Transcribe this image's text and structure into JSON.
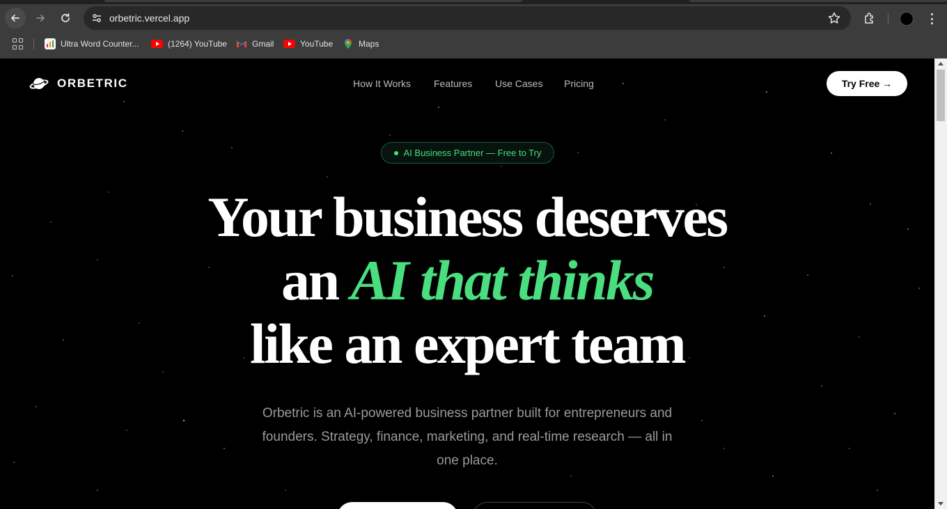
{
  "browser": {
    "url": "orbetric.vercel.app",
    "bookmarks": [
      {
        "label": "Ultra Word Counter...",
        "icon": "ultra-word-counter-favicon"
      },
      {
        "label": "(1264) YouTube",
        "icon": "youtube-favicon"
      },
      {
        "label": "Gmail",
        "icon": "gmail-favicon"
      },
      {
        "label": "YouTube",
        "icon": "youtube-favicon"
      },
      {
        "label": "Maps",
        "icon": "maps-favicon"
      }
    ]
  },
  "header": {
    "logo_text": "ORBETRIC",
    "nav": [
      "How It Works",
      "Features",
      "Use Cases",
      "Pricing"
    ],
    "cta_label": "Try Free →"
  },
  "hero": {
    "badge": "AI Business Partner — Free to Try",
    "line1": "Your business deserves",
    "line2_prefix": "an",
    "line2_accent": "AI that thinks",
    "line3": "like an expert team",
    "subtitle": "Orbetric is an AI-powered business partner built for entrepreneurs and founders. Strategy, finance, marketing, and real-time research — all in one place."
  },
  "colors": {
    "accent": "#4ade80",
    "background": "#000000",
    "chrome": "#3c3c3c"
  }
}
